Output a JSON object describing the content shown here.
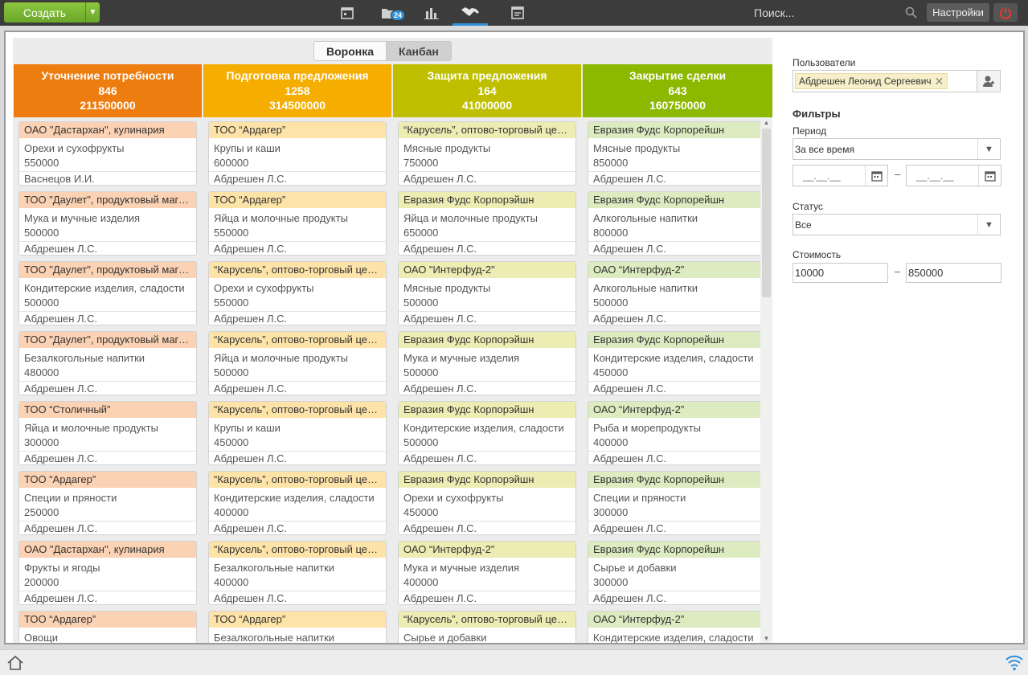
{
  "topbar": {
    "create_label": "Создать",
    "folder_badge": "24",
    "search_placeholder": "Поиск...",
    "settings_label": "Настройки"
  },
  "view_toggle": {
    "funnel": "Воронка",
    "kanban": "Канбан",
    "active": "funnel"
  },
  "columns": [
    {
      "title": "Уточнение потребности",
      "count": "846",
      "sum": "211500000",
      "color": "#ee7d0f",
      "tint": "#fbd2b3",
      "cards": [
        {
          "company": "ОАО \"Дастархан\", кулинария",
          "product": "Орехи и сухофрукты",
          "amount": "550000",
          "user": "Васнецов И.И."
        },
        {
          "company": "ТОО \"Даулет\", продуктовый магазин",
          "product": "Мука и мучные изделия",
          "amount": "500000",
          "user": "Абдрешен Л.С."
        },
        {
          "company": "ТОО \"Даулет\", продуктовый магазин",
          "product": "Кондитерские изделия, сладости",
          "amount": "500000",
          "user": "Абдрешен Л.С."
        },
        {
          "company": "ТОО \"Даулет\", продуктовый магазин",
          "product": "Безалкогольные напитки",
          "amount": "480000",
          "user": "Абдрешен Л.С."
        },
        {
          "company": "ТОО “Столичный”",
          "product": "Яйца и молочные продукты",
          "amount": "300000",
          "user": "Абдрешен Л.С."
        },
        {
          "company": "ТОО “Ардагер”",
          "product": "Специи и пряности",
          "amount": "250000",
          "user": "Абдрешен Л.С."
        },
        {
          "company": "ОАО \"Дастархан\", кулинария",
          "product": "Фрукты и ягоды",
          "amount": "200000",
          "user": "Абдрешен Л.С."
        },
        {
          "company": "ТОО “Ардагер”",
          "product": "Овощи",
          "amount": "",
          "user": ""
        }
      ]
    },
    {
      "title": "Подготовка предложения",
      "count": "1258",
      "sum": "314500000",
      "color": "#f5ad00",
      "tint": "#fde3a7",
      "cards": [
        {
          "company": "ТОО “Ардагер”",
          "product": "Крупы и каши",
          "amount": "600000",
          "user": "Абдрешен Л.С."
        },
        {
          "company": "ТОО “Ардагер”",
          "product": "Яйца и молочные продукты",
          "amount": "550000",
          "user": "Абдрешен Л.С."
        },
        {
          "company": "“Карусель”, оптово-торговый центр",
          "product": "Орехи и сухофрукты",
          "amount": "550000",
          "user": "Абдрешен Л.С."
        },
        {
          "company": "“Карусель”, оптово-торговый центр",
          "product": "Яйца и молочные продукты",
          "amount": "500000",
          "user": "Абдрешен Л.С."
        },
        {
          "company": "“Карусель”, оптово-торговый центр",
          "product": "Крупы и каши",
          "amount": "450000",
          "user": "Абдрешен Л.С."
        },
        {
          "company": "“Карусель”, оптово-торговый центр",
          "product": "Кондитерские изделия, сладости",
          "amount": "400000",
          "user": "Абдрешен Л.С."
        },
        {
          "company": "“Карусель”, оптово-торговый центр",
          "product": "Безалкогольные напитки",
          "amount": "400000",
          "user": "Абдрешен Л.С."
        },
        {
          "company": "ТОО “Ардагер”",
          "product": "Безалкогольные напитки",
          "amount": "",
          "user": ""
        }
      ]
    },
    {
      "title": "Защита предложения",
      "count": "164",
      "sum": "41000000",
      "color": "#bfbf00",
      "tint": "#ececb3",
      "cards": [
        {
          "company": "“Карусель”, оптово-торговый центр",
          "product": "Мясные продукты",
          "amount": "750000",
          "user": "Абдрешен Л.С."
        },
        {
          "company": "Евразия Фудс Корпорэйшн",
          "product": "Яйца и молочные продукты",
          "amount": "650000",
          "user": "Абдрешен Л.С."
        },
        {
          "company": "ОАО \"Интерфуд-2\"",
          "product": "Мясные продукты",
          "amount": "500000",
          "user": "Абдрешен Л.С."
        },
        {
          "company": "Евразия Фудс Корпорэйшн",
          "product": "Мука и мучные изделия",
          "amount": "500000",
          "user": "Абдрешен Л.С."
        },
        {
          "company": "Евразия Фудс Корпорэйшн",
          "product": "Кондитерские изделия, сладости",
          "amount": "500000",
          "user": "Абдрешен Л.С."
        },
        {
          "company": "Евразия Фудс Корпорэйшн",
          "product": "Орехи и сухофрукты",
          "amount": "450000",
          "user": "Абдрешен Л.С."
        },
        {
          "company": "ОАО “Интерфуд-2”",
          "product": "Мука и мучные изделия",
          "amount": "400000",
          "user": "Абдрешен Л.С."
        },
        {
          "company": "“Карусель”, оптово-торговый центр",
          "product": "Сырье и добавки",
          "amount": "",
          "user": ""
        }
      ]
    },
    {
      "title": "Закрытие сделки",
      "count": "643",
      "sum": "160750000",
      "color": "#8cb800",
      "tint": "#dcebc0",
      "cards": [
        {
          "company": "Евразия Фудс Корпорейшн",
          "product": "Мясные продукты",
          "amount": "850000",
          "user": "Абдрешен Л.С."
        },
        {
          "company": "Евразия Фудс Корпорейшн",
          "product": "Алкогольные напитки",
          "amount": "800000",
          "user": "Абдрешен Л.С."
        },
        {
          "company": "ОАО “Интерфуд-2”",
          "product": "Алкогольные напитки",
          "amount": "500000",
          "user": "Абдрешен Л.С."
        },
        {
          "company": "Евразия Фудс Корпорейшн",
          "product": "Кондитерские изделия, сладости",
          "amount": "450000",
          "user": "Абдрешен Л.С."
        },
        {
          "company": "ОАО “Интерфуд-2”",
          "product": "Рыба и морепродукты",
          "amount": "400000",
          "user": "Абдрешен Л.С."
        },
        {
          "company": "Евразия Фудс Корпорейшн",
          "product": "Специи и пряности",
          "amount": "300000",
          "user": "Абдрешен Л.С."
        },
        {
          "company": "Евразия Фудс Корпорейшн",
          "product": "Сырье и добавки",
          "amount": "300000",
          "user": "Абдрешен Л.С."
        },
        {
          "company": "ОАО “Интерфуд-2”",
          "product": "Кондитерские изделия, сладости",
          "amount": "",
          "user": ""
        }
      ]
    }
  ],
  "filters": {
    "users_label": "Пользователи",
    "selected_user": "Абдрешен Леонид Сергеевич",
    "filters_title": "Фильтры",
    "period_label": "Период",
    "period_value": "За все время",
    "date_from": "__.__.__",
    "date_to": "__.__.__",
    "date_sep": "–",
    "status_label": "Статус",
    "status_value": "Все",
    "cost_label": "Стоимость",
    "cost_from": "10000",
    "cost_to": "850000",
    "cost_sep": "–"
  },
  "icons": {
    "calendar": "calendar-icon",
    "folder": "folder-icon",
    "chart": "bar-chart-icon",
    "deals": "handshake-icon",
    "report": "report-icon",
    "search": "search-icon",
    "power": "power-icon",
    "home": "home-icon",
    "wifi": "wifi-icon"
  }
}
